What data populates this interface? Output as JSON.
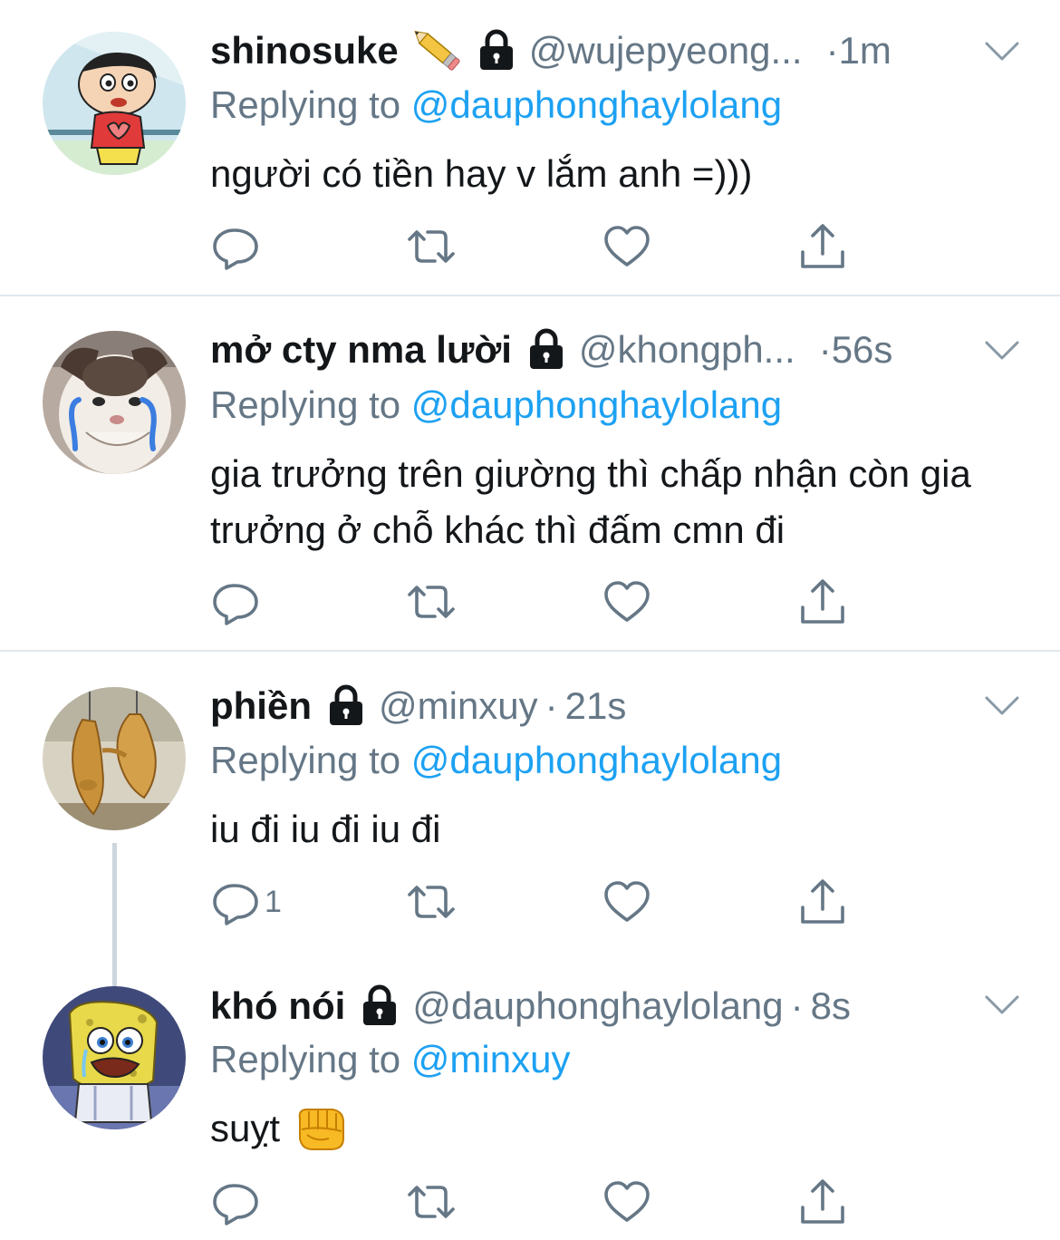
{
  "colors": {
    "text": "#14171a",
    "secondary": "#657786",
    "link": "#1da1f2",
    "divider": "#e1e8ed"
  },
  "tweets": [
    {
      "display_name": "shinosuke",
      "handle": "@wujepyeong...",
      "time": "1m",
      "reply_label": "Replying to",
      "reply_to": "@dauphonghaylolang",
      "text": "người có tiền hay v lắm anh =)))",
      "reply_count": "",
      "avatar_icon": "shinchan-avatar",
      "badge_icons": [
        "pencil-emoji-icon",
        "lock-icon"
      ]
    },
    {
      "display_name": "mở cty nma lười",
      "handle": "@khongph...",
      "time": "56s",
      "reply_label": "Replying to",
      "reply_to": "@dauphonghaylolang",
      "text": "gia trưởng trên giường thì chấp nhận còn gia trưởng ở chỗ khác thì đấm cmn đi",
      "reply_count": "",
      "avatar_icon": "crying-cat-avatar",
      "badge_icons": [
        "lock-icon"
      ]
    },
    {
      "display_name": "phiền",
      "handle": "@minxuy",
      "time": "21s",
      "reply_label": "Replying to",
      "reply_to": "@dauphonghaylolang",
      "text": "iu đi iu đi iu đi",
      "reply_count": "1",
      "avatar_icon": "chicken-avatar",
      "badge_icons": [
        "lock-icon"
      ]
    },
    {
      "display_name": "khó nói",
      "handle": "@dauphonghaylolang",
      "time": "8s",
      "reply_label": "Replying to",
      "reply_to": "@minxuy",
      "text": "suỵt",
      "reply_count": "",
      "avatar_icon": "spongebob-avatar",
      "badge_icons": [
        "lock-icon"
      ],
      "text_emoji": "punch-emoji-icon"
    }
  ]
}
